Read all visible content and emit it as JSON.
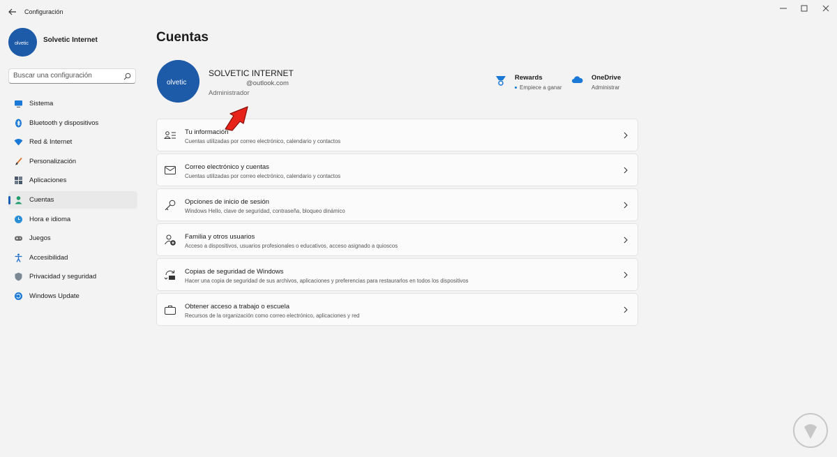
{
  "window": {
    "title": "Configuración"
  },
  "user": {
    "sidebar_name": "Solvetic Internet",
    "account_name": "SOLVETIC INTERNET",
    "email": "@outlook.com",
    "role": "Administrador",
    "avatar_logo": "olvetic"
  },
  "search": {
    "placeholder": "Buscar una configuración",
    "value": ""
  },
  "nav": {
    "items": [
      {
        "label": "Sistema",
        "icon": "monitor-icon"
      },
      {
        "label": "Bluetooth y dispositivos",
        "icon": "bluetooth-icon"
      },
      {
        "label": "Red & Internet",
        "icon": "wifi-icon"
      },
      {
        "label": "Personalización",
        "icon": "brush-icon"
      },
      {
        "label": "Aplicaciones",
        "icon": "apps-icon"
      },
      {
        "label": "Cuentas",
        "icon": "person-icon",
        "active": true
      },
      {
        "label": "Hora e idioma",
        "icon": "globe-clock-icon"
      },
      {
        "label": "Juegos",
        "icon": "gamepad-icon"
      },
      {
        "label": "Accesibilidad",
        "icon": "accessibility-icon"
      },
      {
        "label": "Privacidad y seguridad",
        "icon": "shield-icon"
      },
      {
        "label": "Windows Update",
        "icon": "update-icon"
      }
    ]
  },
  "page": {
    "title": "Cuentas"
  },
  "quick_links": {
    "rewards": {
      "title": "Rewards",
      "subtitle": "Empiece a ganar",
      "icon": "trophy-icon"
    },
    "onedrive": {
      "title": "OneDrive",
      "subtitle": "Administrar",
      "icon": "cloud-icon"
    }
  },
  "cards": [
    {
      "title": "Tu información",
      "subtitle": "Cuentas utilizadas por correo electrónico, calendario y contactos",
      "icon": "person-info-icon"
    },
    {
      "title": "Correo electrónico y cuentas",
      "subtitle": "Cuentas utilizadas por correo electrónico, calendario y contactos",
      "icon": "mail-icon"
    },
    {
      "title": "Opciones de inicio de sesión",
      "subtitle": "Windows Hello, clave de seguridad, contraseña, bloqueo dinámico",
      "icon": "key-icon"
    },
    {
      "title": "Familia y otros usuarios",
      "subtitle": "Acceso a dispositivos, usuarios profesionales o educativos, acceso asignado a quioscos",
      "icon": "family-icon"
    },
    {
      "title": "Copias de seguridad de Windows",
      "subtitle": "Hacer una copia de seguridad de sus archivos, aplicaciones y preferencias para restaurarlos en todos los dispositivos",
      "icon": "backup-icon"
    },
    {
      "title": "Obtener acceso a trabajo o escuela",
      "subtitle": "Recursos de la organización como correo electrónico, aplicaciones y red",
      "icon": "briefcase-icon"
    }
  ],
  "colors": {
    "accent": "#0078d4",
    "nav_indicator": "#1a5fb4",
    "avatar": "#1d5aa8",
    "annotation_arrow": "#e8231a"
  }
}
